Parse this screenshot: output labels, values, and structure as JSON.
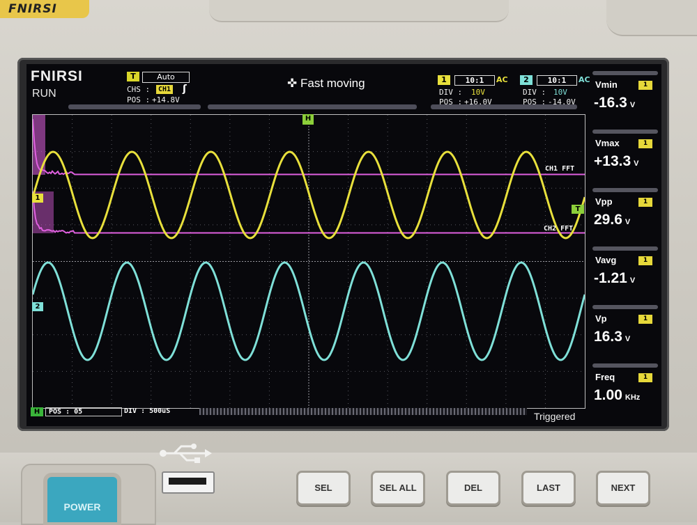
{
  "device": {
    "brand_plate": "FNIRSI",
    "usb_symbol": "usb-icon",
    "buttons": {
      "power": "POWER",
      "sel": "SEL",
      "sel_all": "SEL ALL",
      "del": "DEL",
      "last": "LAST",
      "next": "NEXT"
    }
  },
  "screen": {
    "logo": "FNIRSI",
    "run_state": "RUN",
    "trigger": {
      "badge": "T",
      "mode": "Auto",
      "chs_label": "CHS :",
      "chs_value": "CH1",
      "pos_label": "POS :",
      "pos_value": "+14.8V"
    },
    "status_message": "Fast moving",
    "ch1": {
      "tag": "1",
      "probe": "10:1",
      "coupling": "AC",
      "div_label": "DIV :",
      "div_value": "10V",
      "pos_label": "POS :",
      "pos_value": "+16.0V",
      "color": "#e8e03c"
    },
    "ch2": {
      "tag": "2",
      "probe": "10:1",
      "coupling": "AC",
      "div_label": "DIV :",
      "div_value": "10V",
      "pos_label": "POS :",
      "pos_value": "-14.0V",
      "color": "#7fe0d8"
    },
    "fft_color": "#e060e0",
    "markers": {
      "h": "H",
      "ch1": "1",
      "ch2": "2",
      "trigger": "T"
    },
    "fft_labels": {
      "ch1": "CH1 FFT",
      "ch2": "CH2 FFT"
    },
    "bottom": {
      "h_badge": "H",
      "pos": "POS : 05",
      "div": "DIV : 500uS",
      "trigger_state": "Triggered"
    },
    "measurements": [
      {
        "name": "Vmin",
        "tag": "1",
        "value": "-16.3",
        "unit": "V"
      },
      {
        "name": "Vmax",
        "tag": "1",
        "value": "+13.3",
        "unit": "V"
      },
      {
        "name": "Vpp",
        "tag": "1",
        "value": "29.6",
        "unit": "V"
      },
      {
        "name": "Vavg",
        "tag": "1",
        "value": "-1.21",
        "unit": "V"
      },
      {
        "name": "Vp",
        "tag": "1",
        "value": "16.3",
        "unit": "V"
      },
      {
        "name": "Freq",
        "tag": "1",
        "value": "1.00",
        "unit": "KHz"
      }
    ]
  }
}
